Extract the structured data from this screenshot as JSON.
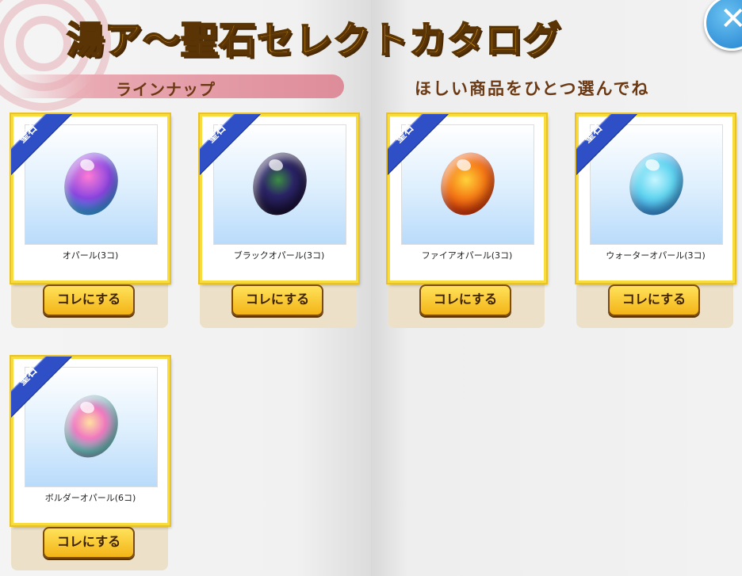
{
  "header": {
    "title": "湯ア〜聖石セレクトカタログ",
    "lineup_label": "ラインナップ",
    "instruction": "ほしい商品をひとつ選んでね",
    "close_symbol": "✕"
  },
  "colors": {
    "title_fill": "#f2b21a",
    "ribbon": "#2f4fc7",
    "button": "#f3b417",
    "close_button": "#1f7fce"
  },
  "items": [
    {
      "ribbon": "聖石",
      "name": "オパール(3コ)",
      "button": "コレにする",
      "gem_color": "#9b4bd6"
    },
    {
      "ribbon": "聖石",
      "name": "ブラックオパール(3コ)",
      "button": "コレにする",
      "gem_color": "#2b1d52"
    },
    {
      "ribbon": "聖石",
      "name": "ファイアオパール(3コ)",
      "button": "コレにする",
      "gem_color": "#f05a12"
    },
    {
      "ribbon": "聖石",
      "name": "ウォーターオパール(3コ)",
      "button": "コレにする",
      "gem_color": "#4ec7ec"
    },
    {
      "ribbon": "聖石",
      "name": "ボルダーオパール(6コ)",
      "button": "コレにする",
      "gem_color": "#d886c9"
    }
  ]
}
